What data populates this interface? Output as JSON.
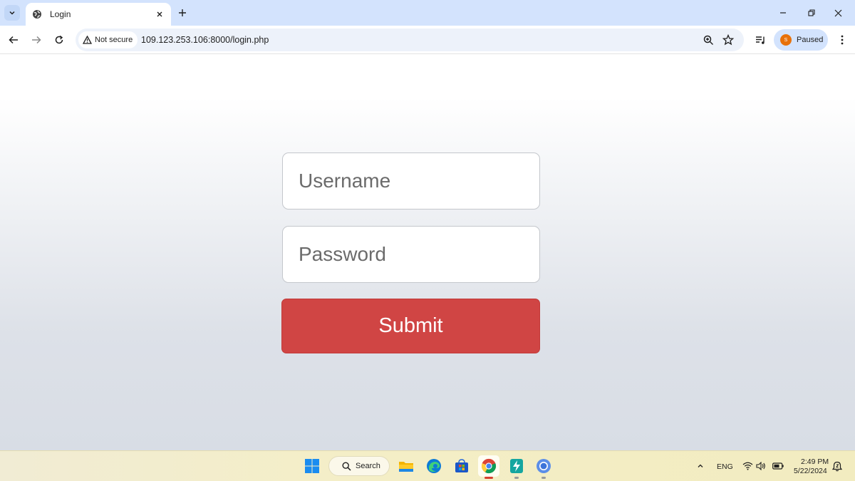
{
  "browser": {
    "tab": {
      "title": "Login"
    },
    "address_bar": {
      "security_label": "Not secure",
      "url": "109.123.253.106:8000/login.php"
    },
    "profile": {
      "initial": "S",
      "label": "Paused",
      "color": "#e8710a"
    }
  },
  "login_form": {
    "username_placeholder": "Username",
    "password_placeholder": "Password",
    "submit_label": "Submit",
    "submit_color": "#d04544"
  },
  "taskbar": {
    "search_label": "Search",
    "apps": [
      "start-icon",
      "file-explorer-icon",
      "edge-icon",
      "microsoft-store-icon",
      "chrome-icon",
      "power-automate-icon",
      "chrome-alt-icon"
    ],
    "tray": {
      "language": "ENG",
      "time": "2:49 PM",
      "date": "5/22/2024"
    }
  }
}
